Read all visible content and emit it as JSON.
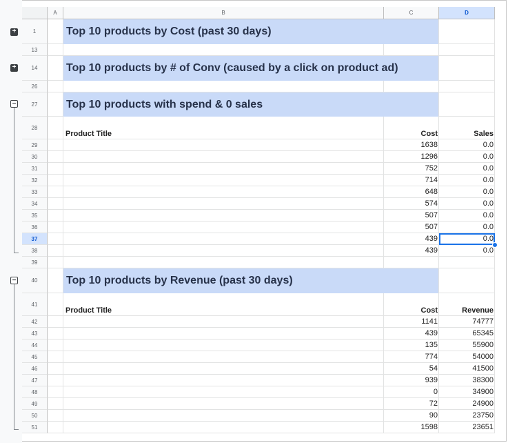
{
  "columns": {
    "a": "A",
    "b": "B",
    "c": "C",
    "d": "D"
  },
  "rows": {
    "r1": "1",
    "r13": "13",
    "r14": "14",
    "r26": "26",
    "r27": "27",
    "r28": "28",
    "r29": "29",
    "r30": "30",
    "r31": "31",
    "r32": "32",
    "r33": "33",
    "r34": "34",
    "r35": "35",
    "r36": "36",
    "r37": "37",
    "r38": "38",
    "r39": "39",
    "r40": "40",
    "r41": "41",
    "r42": "42",
    "r43": "43",
    "r44": "44",
    "r45": "45",
    "r46": "46",
    "r47": "47",
    "r48": "48",
    "r49": "49",
    "r50": "50",
    "r51": "51"
  },
  "sections": {
    "cost": {
      "title": "Top 10 products by Cost (past 30 days)"
    },
    "conv": {
      "title": "Top 10 products by # of Conv (caused by a click on product ad)"
    },
    "zero_sales": {
      "title": "Top 10 products with spend & 0 sales",
      "headers": {
        "product": "Product Title",
        "cost": "Cost",
        "sales": "Sales"
      },
      "rows": [
        {
          "cost": "1638",
          "sales": "0.0"
        },
        {
          "cost": "1296",
          "sales": "0.0"
        },
        {
          "cost": "752",
          "sales": "0.0"
        },
        {
          "cost": "714",
          "sales": "0.0"
        },
        {
          "cost": "648",
          "sales": "0.0"
        },
        {
          "cost": "574",
          "sales": "0.0"
        },
        {
          "cost": "507",
          "sales": "0.0"
        },
        {
          "cost": "507",
          "sales": "0.0"
        },
        {
          "cost": "439",
          "sales": "0.0"
        },
        {
          "cost": "439",
          "sales": "0.0"
        }
      ]
    },
    "revenue": {
      "title": "Top 10 products by Revenue (past 30 days)",
      "headers": {
        "product": "Product Title",
        "cost": "Cost",
        "revenue": "Revenue"
      },
      "rows": [
        {
          "cost": "1141",
          "revenue": "74777"
        },
        {
          "cost": "439",
          "revenue": "65345"
        },
        {
          "cost": "135",
          "revenue": "55900"
        },
        {
          "cost": "774",
          "revenue": "54000"
        },
        {
          "cost": "54",
          "revenue": "41500"
        },
        {
          "cost": "939",
          "revenue": "38300"
        },
        {
          "cost": "0",
          "revenue": "34900"
        },
        {
          "cost": "72",
          "revenue": "24900"
        },
        {
          "cost": "90",
          "revenue": "23750"
        },
        {
          "cost": "1598",
          "revenue": "23651"
        }
      ]
    }
  },
  "group_toggles": {
    "expand": "+",
    "collapse": "−"
  }
}
